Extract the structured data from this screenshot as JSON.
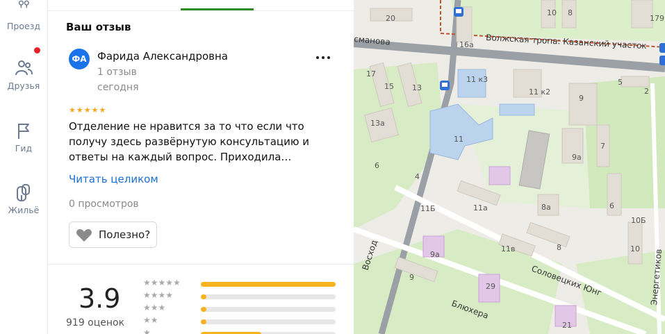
{
  "nav": [
    {
      "label": "Проезд",
      "icon": "route-icon"
    },
    {
      "label": "Друзья",
      "icon": "friends-icon",
      "badge_color": "#e8202a"
    },
    {
      "label": "Гид",
      "icon": "flag-icon"
    },
    {
      "label": "Жильё",
      "icon": "housing-icon"
    }
  ],
  "review": {
    "section_title": "Ваш отзыв",
    "avatar_initials": "ФА",
    "author": "Фарида Александровна",
    "author_reviews": "1 отзыв",
    "date": "сегодня",
    "stars": 5,
    "stars_glyphs": "★★★★★",
    "text": "Отделение не нравится за то что если что получу здесь развёрнутую консультацию и ответы на каждый вопрос. Приходила…",
    "read_more": "Читать целиком",
    "views": "0 просмотров",
    "useful_label": "Полезно?"
  },
  "rating": {
    "value": "3.9",
    "count": "919 оценок",
    "distribution": [
      {
        "stars": "★★★★★",
        "fraction": 1.0
      },
      {
        "stars": "★★★★",
        "fraction": 0.04
      },
      {
        "stars": "★★★",
        "fraction": 0.04
      },
      {
        "stars": "★★",
        "fraction": 0.04
      },
      {
        "stars": "★",
        "fraction": 0.45
      }
    ]
  },
  "map": {
    "streets": [
      "Волжская тропа: Казанский участок",
      "Соловецких Юнг",
      "Блюхера",
      "Восход",
      "Энергетиков",
      "сманова"
    ],
    "buildings": [
      "20",
      "16а",
      "10",
      "8",
      "179",
      "17",
      "15",
      "13",
      "11 к3",
      "11 к2",
      "9",
      "5",
      "2",
      "13а",
      "11",
      "7",
      "9а",
      "4",
      "6",
      "11Б",
      "11а",
      "8а",
      "10Б",
      "11в",
      "8",
      "9а",
      "10",
      "9",
      "29",
      "21",
      "6"
    ],
    "accent_color": "#2e8b22"
  }
}
